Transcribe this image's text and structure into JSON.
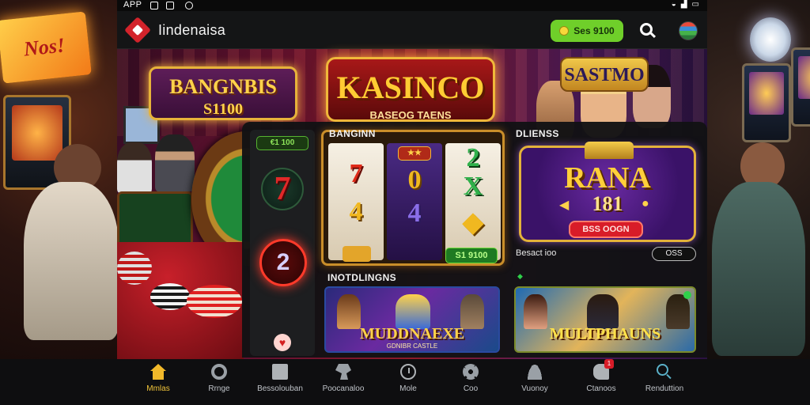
{
  "status_bar": {
    "app_label": "APP"
  },
  "header": {
    "brand": "Iindenaisa",
    "balance_button": "Ses 9100",
    "search_icon": "search-icon",
    "language_icon": "flag-icon"
  },
  "hero": {
    "left_logo_line1": "BANGNBIS",
    "left_logo_line2": "S1100",
    "center_logo_title": "KASINCO",
    "center_logo_sub": "BASEOG TAENS",
    "right_logo": "SASTMO"
  },
  "left_column": {
    "chip": "€1 100",
    "seven_icon": "7",
    "two_icon": "2",
    "heart_icon": "♥"
  },
  "slot_section": {
    "title": "BANGINN",
    "reels": [
      {
        "badge": "",
        "symbols": [
          "7",
          "4"
        ]
      },
      {
        "badge": "★★",
        "symbols": [
          "0",
          "4"
        ]
      },
      {
        "badge": "",
        "symbols": [
          "2",
          "X"
        ]
      }
    ],
    "win_button": "S1 9100"
  },
  "bonus_section": {
    "title": "DLIENSS",
    "name": "RANA",
    "amount": "181",
    "button": "BSS OOGN",
    "footer_text": "Besact ioo",
    "footer_pill": "OSS"
  },
  "recommended": {
    "title": "INOTDLINGNS",
    "games": [
      {
        "title": "MUDDNAEXE",
        "subtitle": "GDNIBR CASTLE"
      },
      {
        "title": "MULTPHAUNS",
        "subtitle": ""
      }
    ]
  },
  "bottom_nav": [
    {
      "label": "Mmlas",
      "icon": "home-icon",
      "active": true
    },
    {
      "label": "Rrnge",
      "icon": "ring-icon",
      "active": false
    },
    {
      "label": "Bessolouban",
      "icon": "square-icon",
      "active": false
    },
    {
      "label": "Poocanaloo",
      "icon": "fist-icon",
      "active": false
    },
    {
      "label": "Mole",
      "icon": "clock-icon",
      "active": false
    },
    {
      "label": "Coo",
      "icon": "gear-icon",
      "active": false
    },
    {
      "label": "Vuonoy",
      "icon": "user-icon",
      "active": false
    },
    {
      "label": "Ctanoos",
      "icon": "chat-icon",
      "active": false,
      "badge": "1"
    },
    {
      "label": "Renduttion",
      "icon": "search-icon",
      "active": false
    }
  ],
  "colors": {
    "accent_green": "#6fcf2a",
    "accent_gold": "#f2c53a",
    "accent_red": "#d81c28",
    "panel": "#121214"
  }
}
